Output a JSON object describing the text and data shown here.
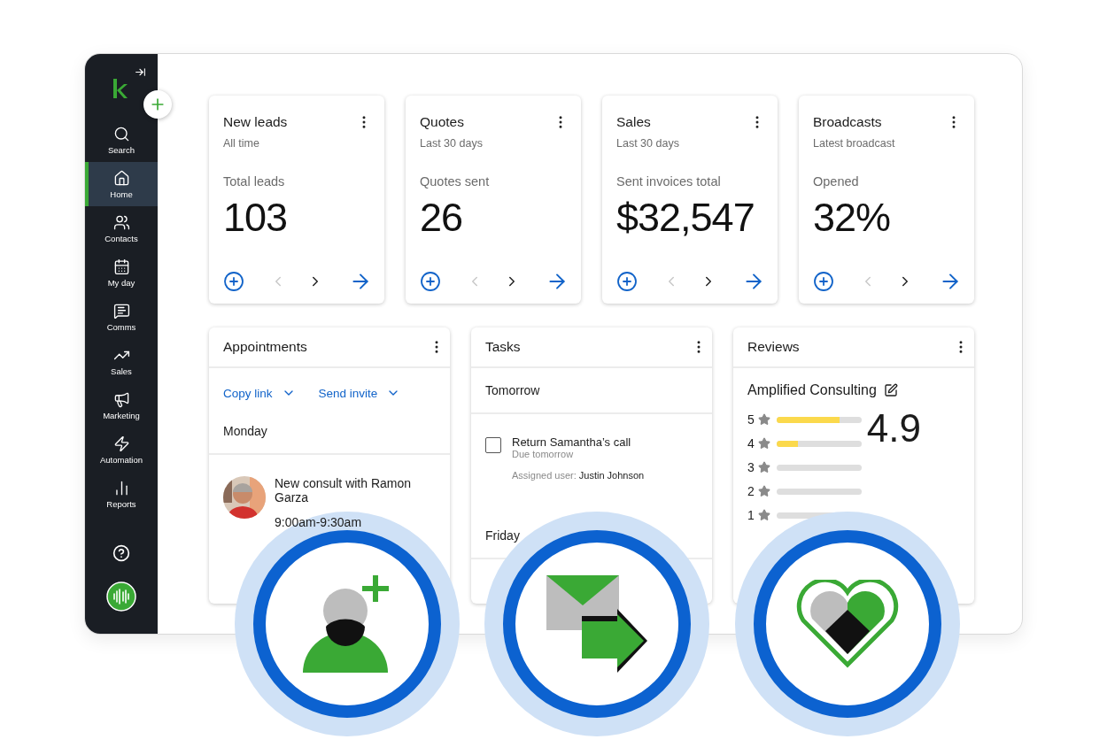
{
  "sidebar": {
    "items": [
      {
        "label": "Search",
        "selected": false
      },
      {
        "label": "Home",
        "selected": true
      },
      {
        "label": "Contacts",
        "selected": false
      },
      {
        "label": "My day",
        "selected": false
      },
      {
        "label": "Comms",
        "selected": false
      },
      {
        "label": "Sales",
        "selected": false
      },
      {
        "label": "Marketing",
        "selected": false
      },
      {
        "label": "Automation",
        "selected": false
      },
      {
        "label": "Reports",
        "selected": false
      }
    ]
  },
  "metrics": [
    {
      "title": "New leads",
      "subtitle": "All time",
      "label": "Total leads",
      "value": "103"
    },
    {
      "title": "Quotes",
      "subtitle": "Last 30 days",
      "label": "Quotes sent",
      "value": "26"
    },
    {
      "title": "Sales",
      "subtitle": "Last 30 days",
      "label": "Sent invoices total",
      "value": "$32,547"
    },
    {
      "title": "Broadcasts",
      "subtitle": "Latest broadcast",
      "label": "Opened",
      "value": "32%"
    }
  ],
  "appointments": {
    "title": "Appointments",
    "actions": [
      "Copy link",
      "Send invite"
    ],
    "day": "Monday",
    "event": {
      "title": "New consult with Ramon Garza",
      "time": "9:00am-9:30am"
    }
  },
  "tasks": {
    "title": "Tasks",
    "sections": [
      {
        "heading": "Tomorrow",
        "items": [
          {
            "title": "Return Samantha’s call",
            "due": "Due tomorrow",
            "assigned_label": "Assigned user:",
            "assignee": "Justin Johnson",
            "checked": false
          }
        ]
      },
      {
        "heading": "Friday"
      }
    ]
  },
  "reviews": {
    "title": "Reviews",
    "business": "Amplified Consulting",
    "score": "4.9",
    "ratings": [
      {
        "label": "5",
        "level": 0.74
      },
      {
        "label": "4",
        "level": 0.25
      },
      {
        "label": "3"
      },
      {
        "label": "2"
      },
      {
        "label": "1"
      }
    ]
  }
}
